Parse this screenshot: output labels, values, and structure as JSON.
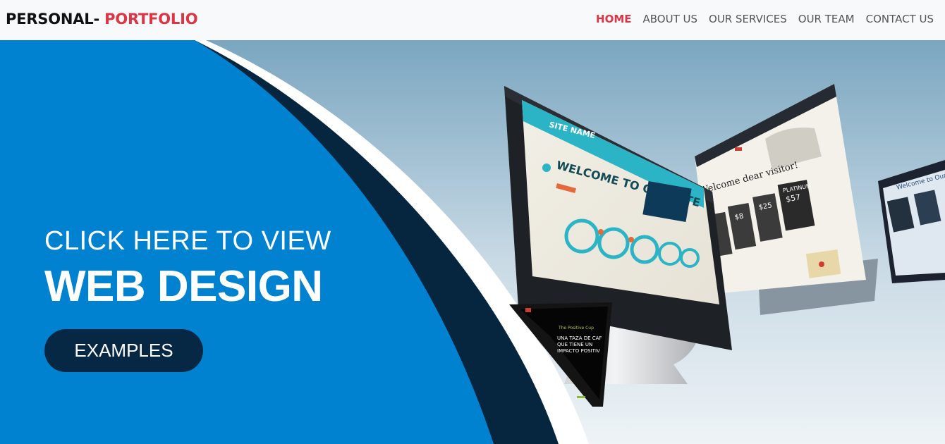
{
  "brand": {
    "part1": "PERSONAL- ",
    "part2": "PORTFOLIO"
  },
  "nav": {
    "home": "HOME",
    "about": "ABOUT US",
    "services": "OUR SERVICES",
    "team": "OUR TEAM",
    "contact": "CONTACT US"
  },
  "hero": {
    "line1": "CLICK HERE TO VIEW",
    "line2": "WEB DESIGN",
    "button": "EXAMPLES",
    "mockup": {
      "site_name": "SITE NAME",
      "welcome_main": "WELCOME TO OUR SITE",
      "welcome_side": "Welcome dear visitor!",
      "platinum": "PLATINUM",
      "prices": [
        "$57",
        "$25",
        "$8"
      ],
      "tablet_title": "Welcome to Our Site",
      "laptop_heading": "The Positive Cup",
      "laptop_lines": [
        "UNA TAZA DE CAF",
        "QUE TIENE UN",
        "IMPACTO POSITIV"
      ]
    }
  },
  "colors": {
    "accent": "#dc3545",
    "hero_blue": "#0082d0",
    "navy": "#072844"
  }
}
